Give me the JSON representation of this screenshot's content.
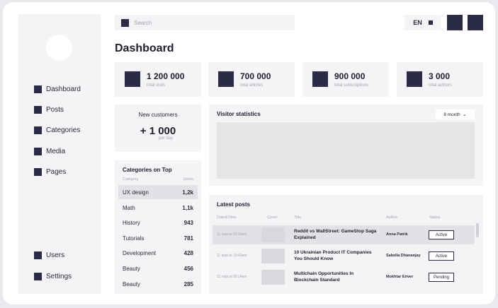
{
  "search": {
    "placeholder": "Search"
  },
  "header": {
    "language": "EN"
  },
  "page_title": "Dashboard",
  "sidebar": {
    "items": [
      {
        "label": "Dashboard"
      },
      {
        "label": "Posts"
      },
      {
        "label": "Categories"
      },
      {
        "label": "Media"
      },
      {
        "label": "Pages"
      }
    ],
    "bottom_items": [
      {
        "label": "Users"
      },
      {
        "label": "Settings"
      }
    ]
  },
  "stats": [
    {
      "value": "1 200 000",
      "label": "total visits"
    },
    {
      "value": "700 000",
      "label": "total articles"
    },
    {
      "value": "900 000",
      "label": "total subscriptions"
    },
    {
      "value": "3 000",
      "label": "total authors"
    }
  ],
  "new_customers": {
    "title": "New customers",
    "value": "+ 1 000",
    "sub": "per day"
  },
  "categories": {
    "title": "Categories on Top",
    "col_category": "Category",
    "col_users": "Users",
    "rows": [
      {
        "name": "UX design",
        "users": "1,2k"
      },
      {
        "name": "Math",
        "users": "1,1k"
      },
      {
        "name": "History",
        "users": "943"
      },
      {
        "name": "Tutorials",
        "users": "781"
      },
      {
        "name": "Development",
        "users": "428"
      },
      {
        "name": "Beauty",
        "users": "456"
      },
      {
        "name": "Beauty",
        "users": "285"
      }
    ]
  },
  "visitor_stats": {
    "title": "Visitor statistics",
    "range": "8 month"
  },
  "latest_posts": {
    "title": "Latest posts",
    "columns": [
      "Date&Time",
      "Cover",
      "Title",
      "Author",
      "Status"
    ],
    "rows": [
      {
        "date": "11 sept at 13:30am",
        "title": "Reddit vs WallStreet: GameStop Saga Explained",
        "author": "Anna Patrik",
        "status": "Active"
      },
      {
        "date": "11 sept at 10:43am",
        "title": "10 Ukrainian Product IT Companies You Should Know",
        "author": "Sabella Dhananjay",
        "status": "Active"
      },
      {
        "date": "11 sept at 09:14am",
        "title": "Multichain Opportunities In Blockchain Standard",
        "author": "Mokhtar Enver",
        "status": "Pending"
      }
    ]
  },
  "colors": {
    "accent": "#2b2b47",
    "card": "#f4f4f7",
    "background": "#ffffff"
  }
}
